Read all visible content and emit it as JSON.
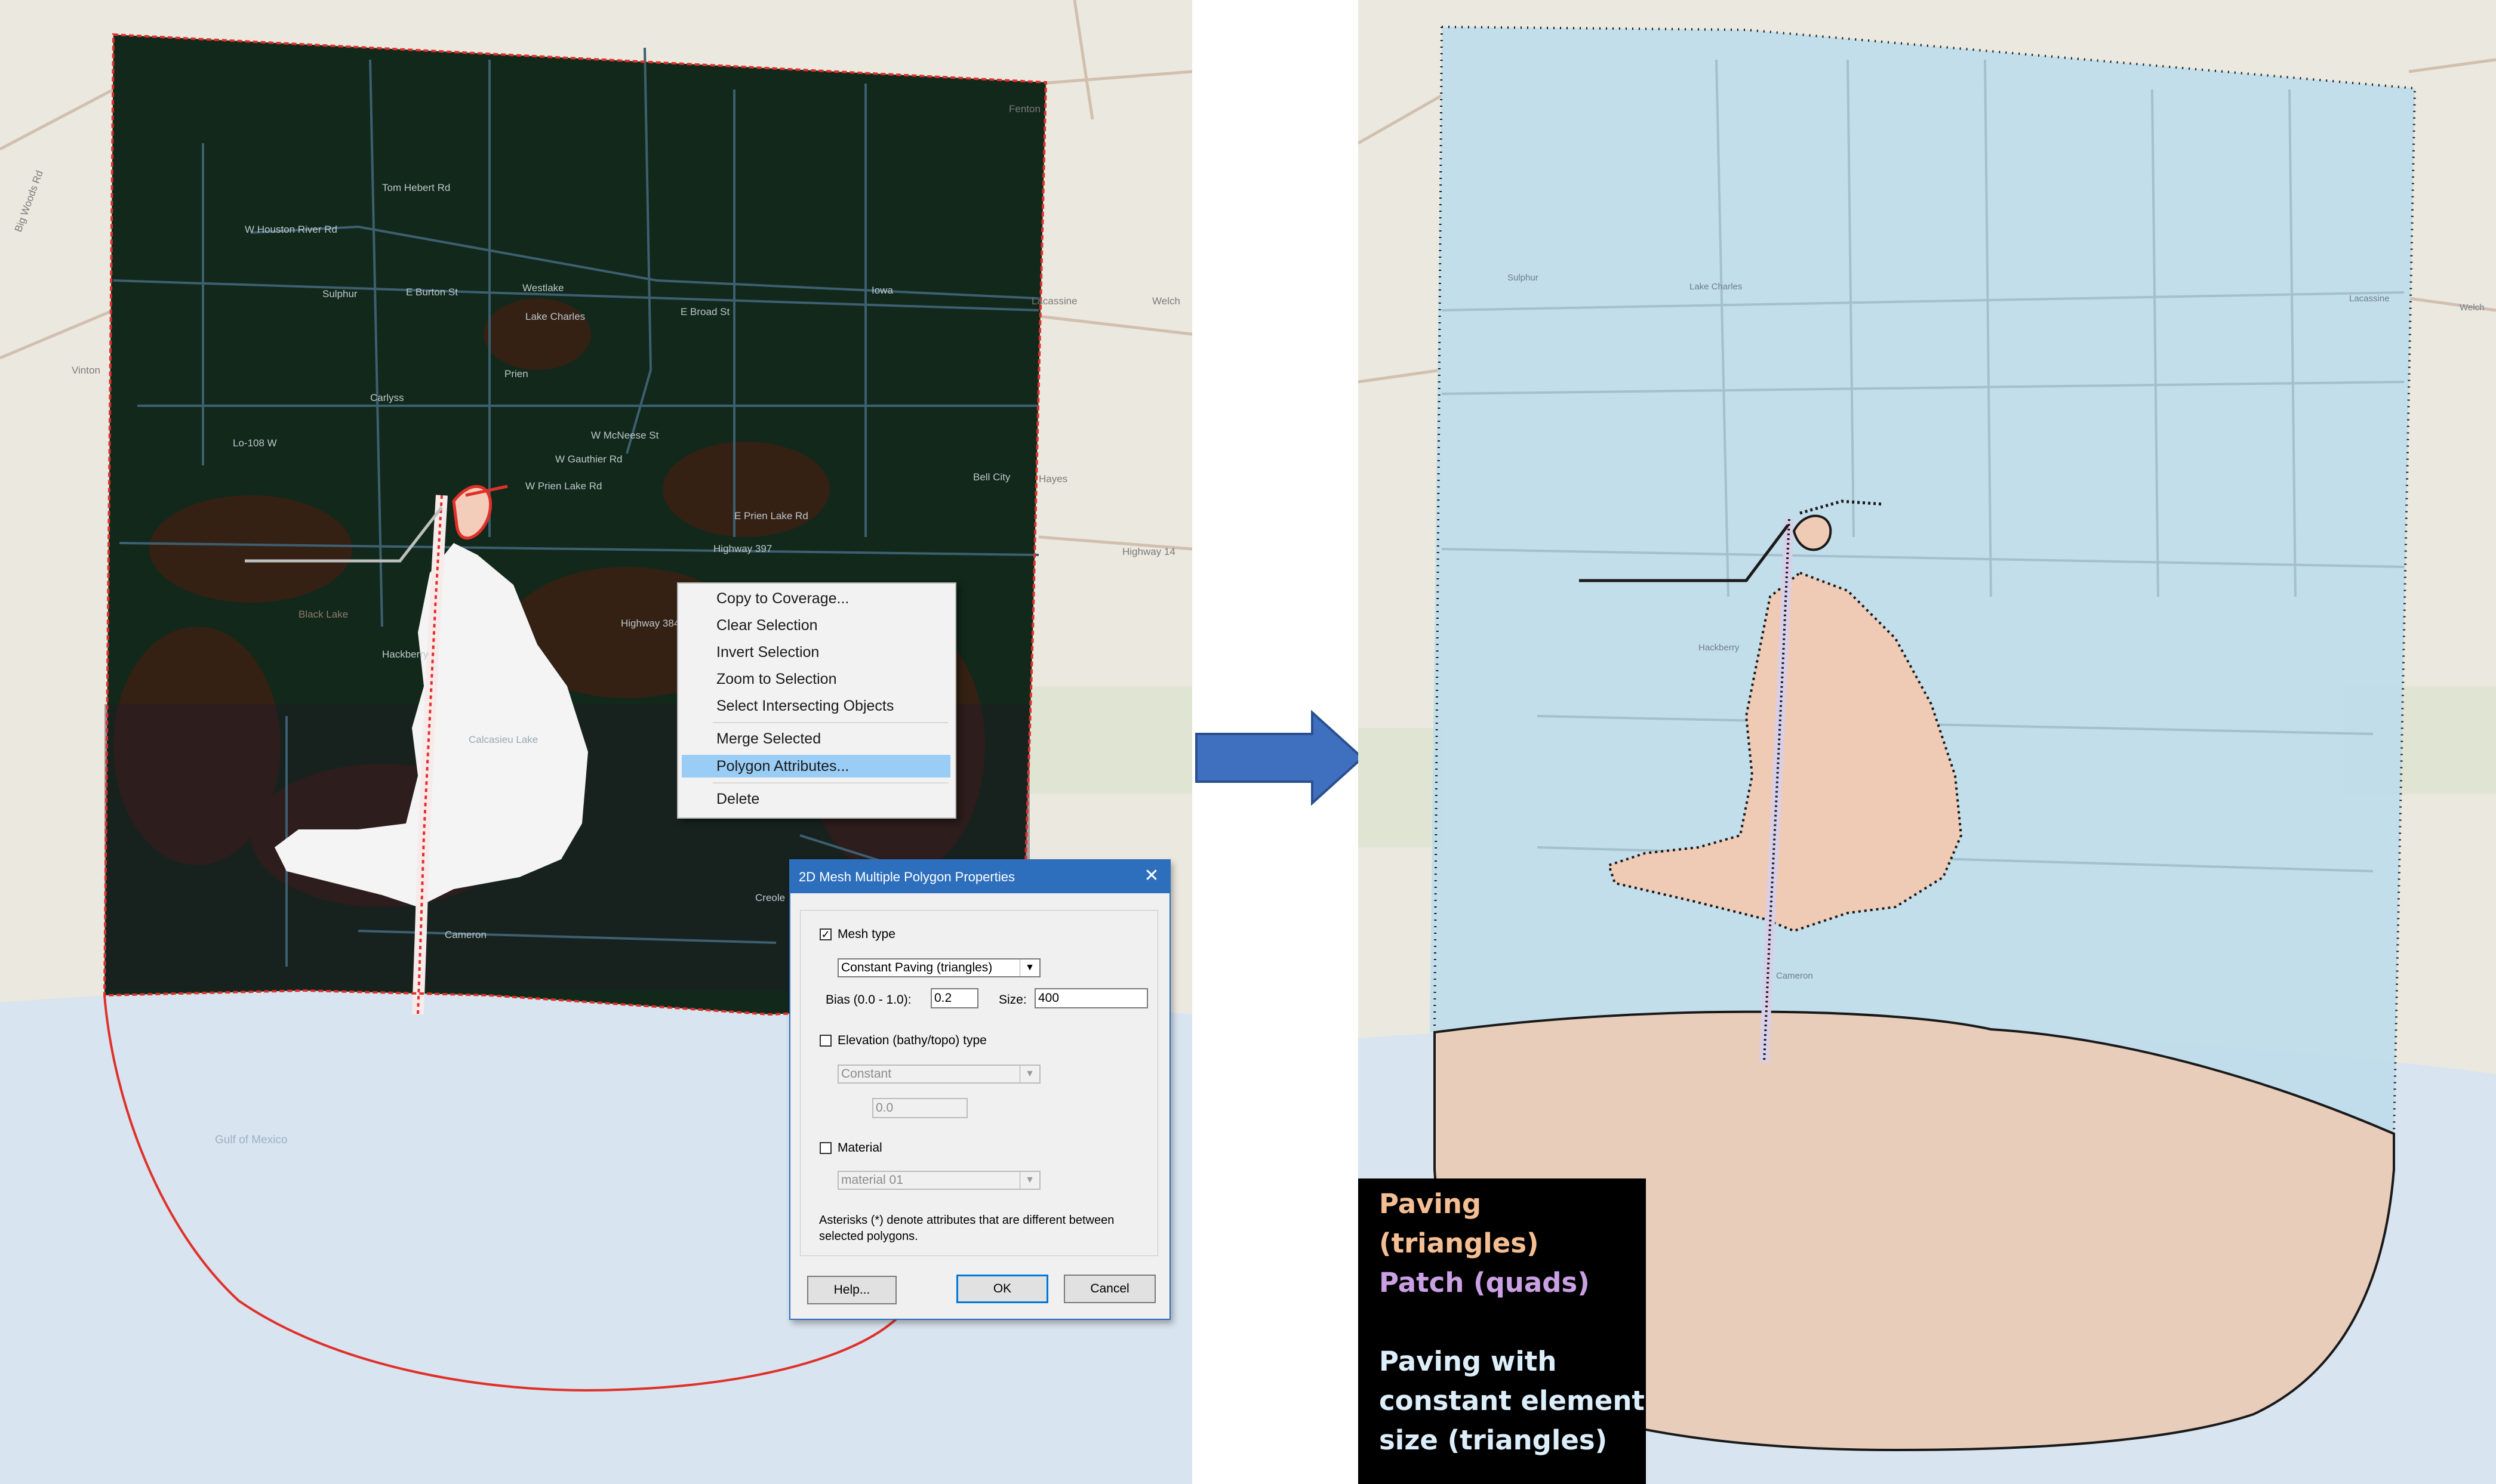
{
  "colors": {
    "map_land": "#e9e7dd",
    "map_water": "#d6e3ef",
    "map_road": "#c9b4a4",
    "dark_mesh": "#0f2a14",
    "dark_mesh_accent": "#3a1a10",
    "selected_outline": "#e0302a",
    "light_blue_polygon": "#bcdaea",
    "paving_fill": "#efcbb6",
    "dialog_title_bar": "#2e6fbd",
    "menu_highlight": "#99cdf6",
    "arrow_fill": "#3f6fbf",
    "legend_bg": "#000000",
    "legend_paving": "#f4be92",
    "legend_patch": "#caa0e4",
    "legend_constant": "#ddeefb"
  },
  "left_map": {
    "place_labels": [
      "Sulphur",
      "Westlake",
      "Lake Charles",
      "Iowa",
      "Lacassine",
      "Welch",
      "Vinton",
      "Carlyss",
      "Prien",
      "Bell City",
      "Hayes",
      "Hackberry",
      "Cameron",
      "Creole",
      "Black Lake",
      "Calcasieu Lake",
      "Gulf of Mexico",
      "Fenton"
    ],
    "road_labels": [
      "W Houston River Rd",
      "E Burton St",
      "E Broad St",
      "W McNeese St",
      "Highway 384",
      "W Gauthier Rd",
      "Lo-108 W",
      "W Prien Lake Rd",
      "E Prien Lake Rd",
      "Highway 14",
      "Highway 397",
      "Tom Hebert Rd",
      "Big Woods Rd"
    ]
  },
  "right_map": {
    "place_labels": [
      "Lake Charles",
      "Welch",
      "Lacassine",
      "Sulphur",
      "Hackberry",
      "Cameron"
    ]
  },
  "context_menu": {
    "items": [
      "Copy to Coverage...",
      "Clear Selection",
      "Invert Selection",
      "Zoom to Selection",
      "Select Intersecting Objects",
      "Merge Selected",
      "Polygon Attributes...",
      "Delete"
    ],
    "highlighted": "Polygon Attributes..."
  },
  "dialog": {
    "title": "2D Mesh Multiple Polygon Properties",
    "close_glyph": "✕",
    "mesh_type": {
      "label": "Mesh type",
      "checked": true,
      "value": "Constant Paving (triangles)"
    },
    "bias": {
      "label": "Bias (0.0 - 1.0):",
      "value": "0.2"
    },
    "size": {
      "label": "Size:",
      "value": "400"
    },
    "elevation": {
      "label": "Elevation (bathy/topo) type",
      "checked": false,
      "value": "Constant",
      "number": "0.0"
    },
    "material": {
      "label": "Material",
      "checked": false,
      "value": "material 01"
    },
    "note": "Asterisks (*) denote attributes that are different between selected polygons.",
    "buttons": {
      "help": "Help...",
      "ok": "OK",
      "cancel": "Cancel"
    },
    "check_mark": "✓",
    "dropdown_glyph": "▼"
  },
  "legend": {
    "paving": "Paving (triangles)",
    "patch": "Patch (quads)",
    "constant_line1": "Paving with",
    "constant_line2": "constant element",
    "constant_line3": "size (triangles)"
  }
}
